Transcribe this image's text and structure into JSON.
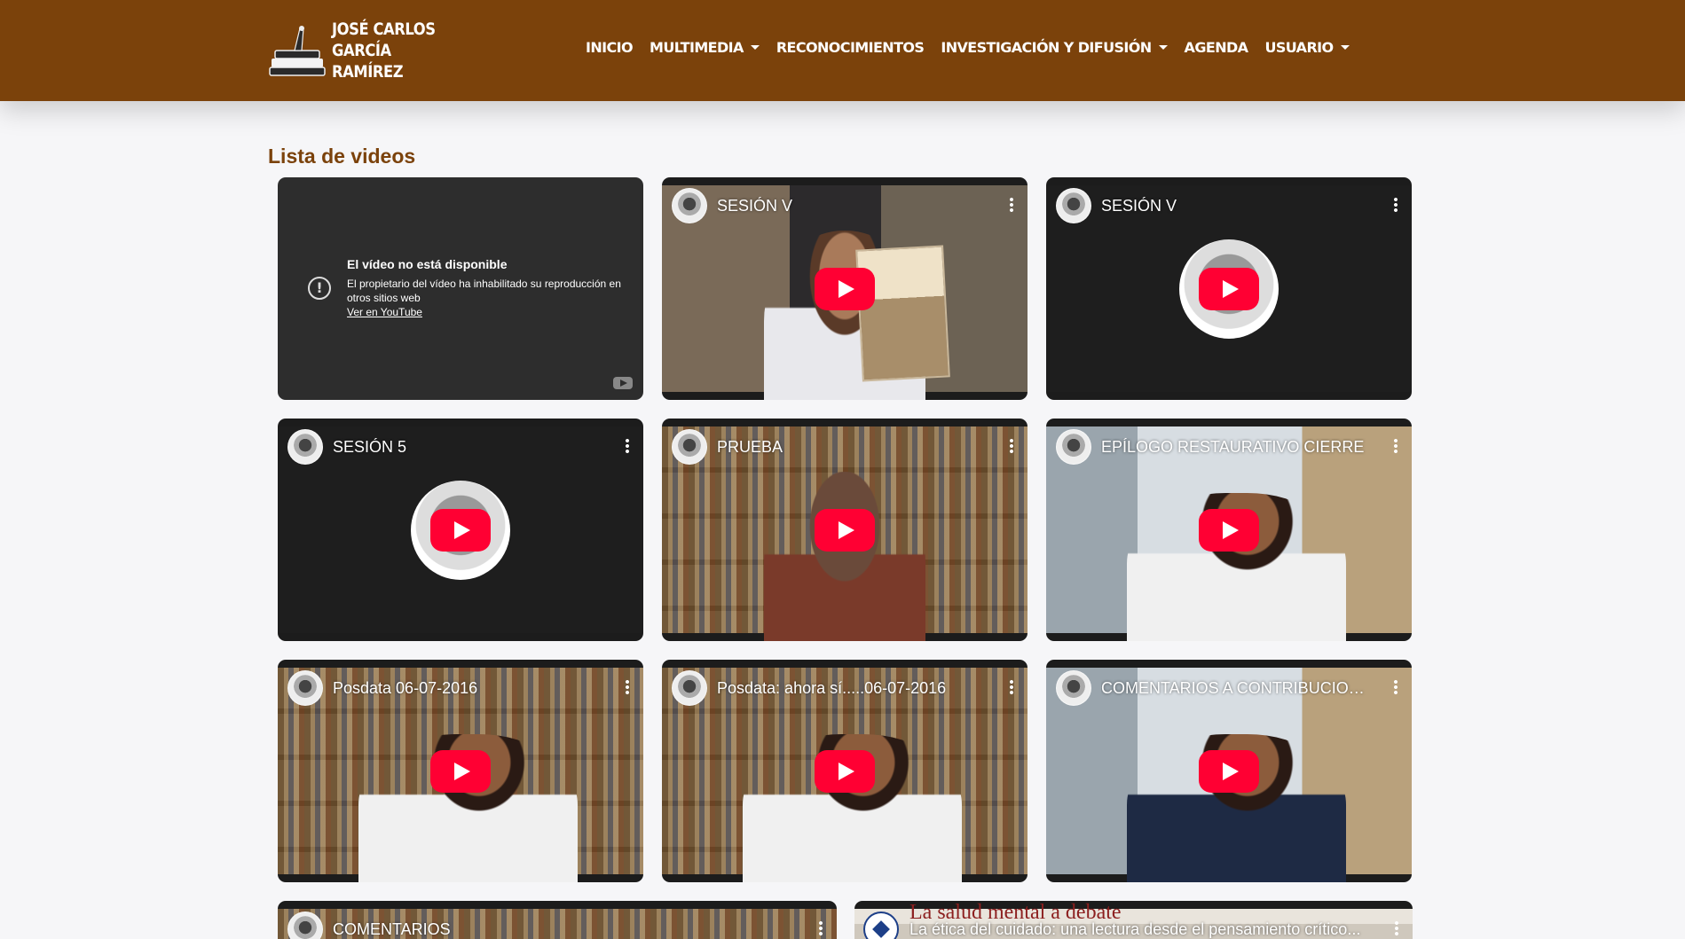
{
  "brand": {
    "line1": "JOSÉ CARLOS",
    "line2": "GARCÍA RAMÍREZ"
  },
  "nav": {
    "items": [
      {
        "label": "INICIO",
        "dropdown": false
      },
      {
        "label": "MULTIMEDIA",
        "dropdown": true
      },
      {
        "label": "RECONOCIMIENTOS",
        "dropdown": false
      },
      {
        "label": "INVESTIGACIÓN Y DIFUSIÓN",
        "dropdown": true
      },
      {
        "label": "AGENDA",
        "dropdown": false
      },
      {
        "label": "USUARIO",
        "dropdown": true
      }
    ]
  },
  "page": {
    "title": "Lista de videos"
  },
  "unavailable": {
    "title": "El vídeo no está disponible",
    "text": "El propietario del vídeo ha inhabilitado su reproducción en otros sitios web",
    "link": "Ver en YouTube"
  },
  "videos": [
    {
      "title": "SESIÓN V"
    },
    {
      "title": "SESIÓN V"
    },
    {
      "title": "SESIÓN 5"
    },
    {
      "title": "PRUEBA"
    },
    {
      "title": "EPÍLOGO RESTAURATIVO CIERRE"
    },
    {
      "title": "Posdata 06-07-2016"
    },
    {
      "title": "Posdata: ahora sí.....06-07-2016"
    },
    {
      "title": "COMENTARIOS A CONTRIBUCION..."
    },
    {
      "title": "COMENTARIOS"
    },
    {
      "title": "La ética del cuidado: una lectura desde el pensamiento crítico...",
      "heading": "La salud mental a debate"
    }
  ],
  "colors": {
    "brand": "#7b420b",
    "play": "#ff0033",
    "background": "#f6f6f8"
  }
}
